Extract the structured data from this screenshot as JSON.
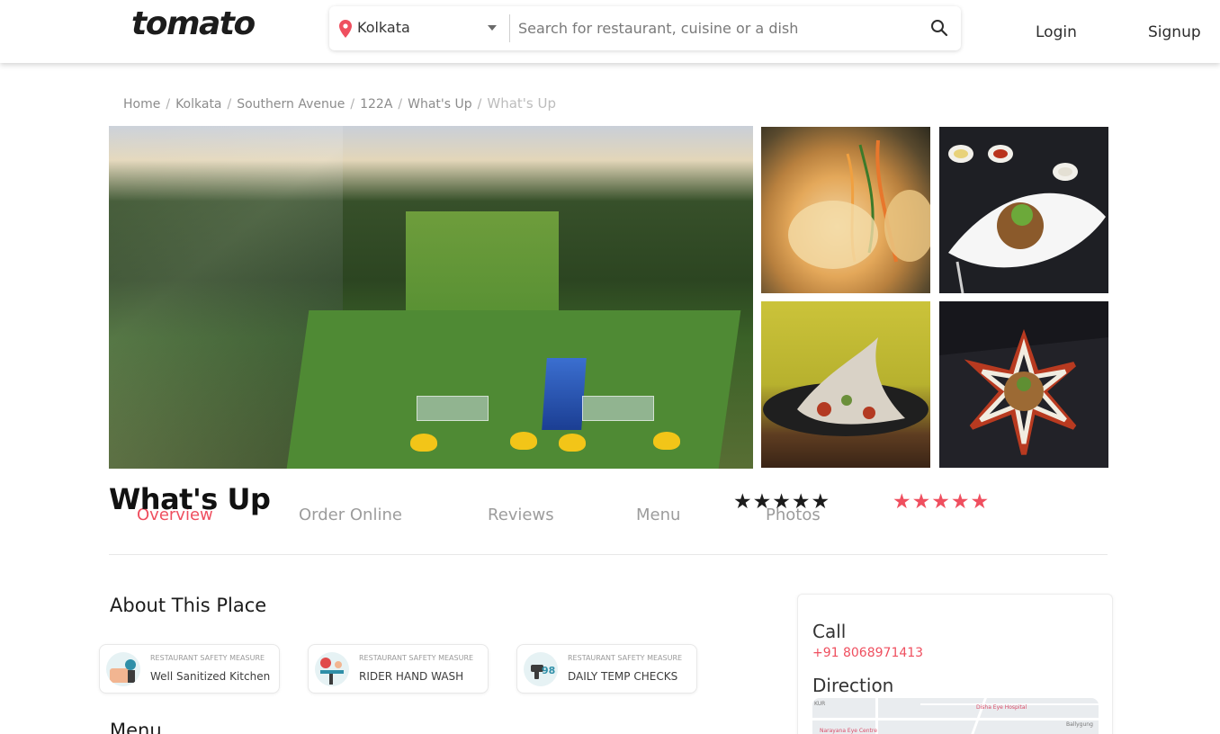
{
  "header": {
    "logo": "tomato",
    "location": "Kolkata",
    "search_placeholder": "Search for restaurant, cuisine or a dish",
    "login": "Login",
    "signup": "Signup"
  },
  "breadcrumb": {
    "items": [
      "Home",
      "Kolkata",
      "Southern Avenue",
      "122A",
      "What's Up"
    ],
    "current": "What's Up"
  },
  "restaurant": {
    "name": "What's Up"
  },
  "tabs": [
    {
      "label": "Overview",
      "active": true
    },
    {
      "label": "Order Online",
      "active": false
    },
    {
      "label": "Reviews",
      "active": false
    },
    {
      "label": "Menu",
      "active": false
    },
    {
      "label": "Photos",
      "active": false
    }
  ],
  "ratings": {
    "dark_stars": "★★★★★",
    "red_stars": "★★★★★",
    "dark_count": 5,
    "red_count": 5
  },
  "about": {
    "heading": "About This Place",
    "measures": [
      {
        "kicker": "RESTAURANT SAFETY MEASURE",
        "label": "Well Sanitized Kitchen",
        "icon": "kitchen-icon"
      },
      {
        "kicker": "RESTAURANT SAFETY MEASURE",
        "label": "RIDER HAND WASH",
        "icon": "hand-wash-icon"
      },
      {
        "kicker": "RESTAURANT SAFETY MEASURE",
        "label": "DAILY TEMP CHECKS",
        "icon": "thermometer-icon"
      }
    ]
  },
  "menu_heading": "Menu",
  "contact": {
    "call_label": "Call",
    "phone": "+91 8068971413",
    "direction_label": "Direction",
    "map_labels": [
      "KUR",
      "Disha Eye Hospital",
      "Ballygung",
      "Narayana Eye Centre"
    ]
  },
  "colors": {
    "accent": "#ef4f5f",
    "text": "#1c1c1c",
    "muted": "#9c9c9c"
  }
}
